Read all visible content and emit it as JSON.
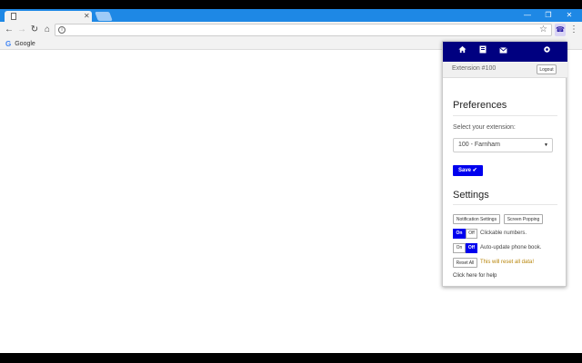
{
  "browser": {
    "tab_close": "✕",
    "window_buttons": [
      "—",
      "❐",
      "✕"
    ],
    "nav": {
      "back": "←",
      "forward": "→",
      "reload": "↻",
      "home": "⌂"
    },
    "omnibox_value": "",
    "bookmarks": [
      {
        "icon": "G",
        "label": "Google"
      }
    ]
  },
  "popup": {
    "extension_label": "Extension #100",
    "logout_label": "Logout",
    "preferences": {
      "title": "Preferences",
      "select_label": "Select your extension:",
      "select_value": "100 - Farnham",
      "save_label": "Save ✔"
    },
    "settings": {
      "title": "Settings",
      "notification_settings": "Notification Settings",
      "screen_popping": "Screen Popping",
      "clickable_numbers": {
        "on": "On",
        "off": "Off",
        "label": "Clickable numbers.",
        "state": "on"
      },
      "auto_update": {
        "on": "On",
        "off": "Off",
        "label": "Auto-update phone book.",
        "state": "off"
      },
      "reset_label": "Reset All",
      "reset_warning": "This will reset all data!",
      "help_link": "Click here for help"
    }
  },
  "colors": {
    "titlebar": "#1e88e5",
    "popup_nav": "#000080",
    "accent_blue": "#0000ee",
    "warning": "#b8860b"
  }
}
